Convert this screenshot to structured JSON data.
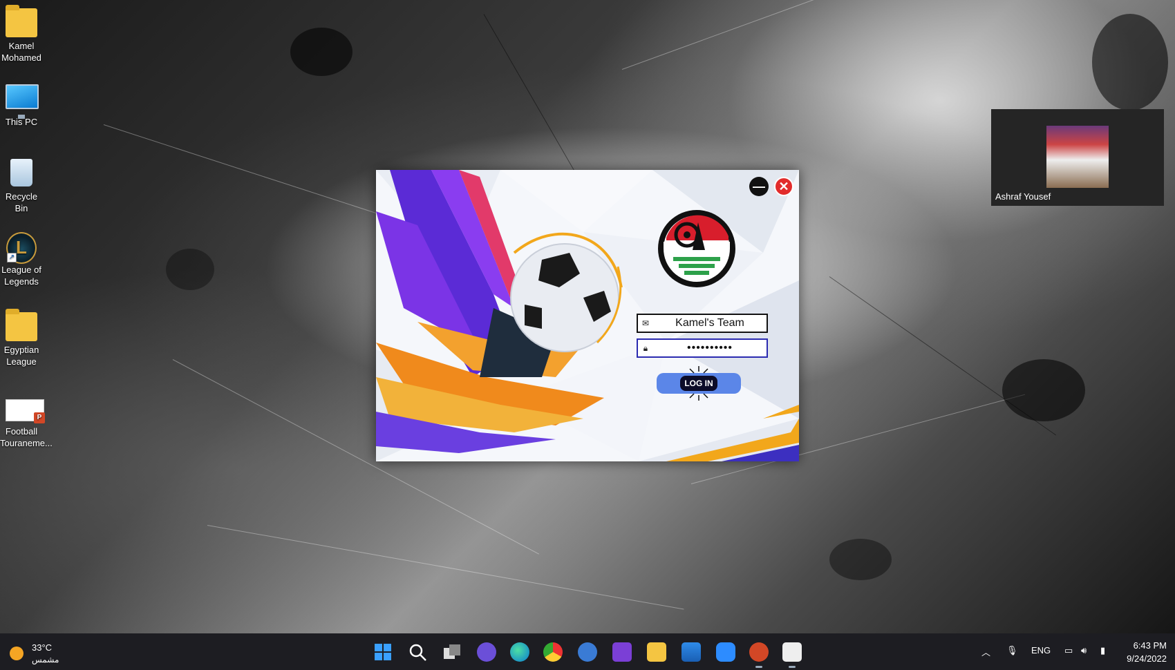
{
  "desktop": {
    "icons": [
      {
        "label": "Kamel Mohamed"
      },
      {
        "label": "This PC"
      },
      {
        "label": "Recycle Bin"
      },
      {
        "label": "League of Legends"
      },
      {
        "label": "Egyptian League"
      },
      {
        "label": "Football Touraneme..."
      }
    ]
  },
  "login": {
    "username_value": "Kamel's Team",
    "password_value": "••••••••••",
    "login_label": "LOG IN",
    "minimize_symbol": "—",
    "close_symbol": "✕"
  },
  "video": {
    "participant_name": "Ashraf Yousef"
  },
  "taskbar": {
    "weather_temp": "33°C",
    "weather_condition": "مشمس",
    "language": "ENG",
    "time": "6:43 PM",
    "date": "9/24/2022"
  },
  "colors": {
    "login_button": "#5b86e8",
    "close_button": "#e22c2c",
    "taskbar": "#1d1d22"
  }
}
